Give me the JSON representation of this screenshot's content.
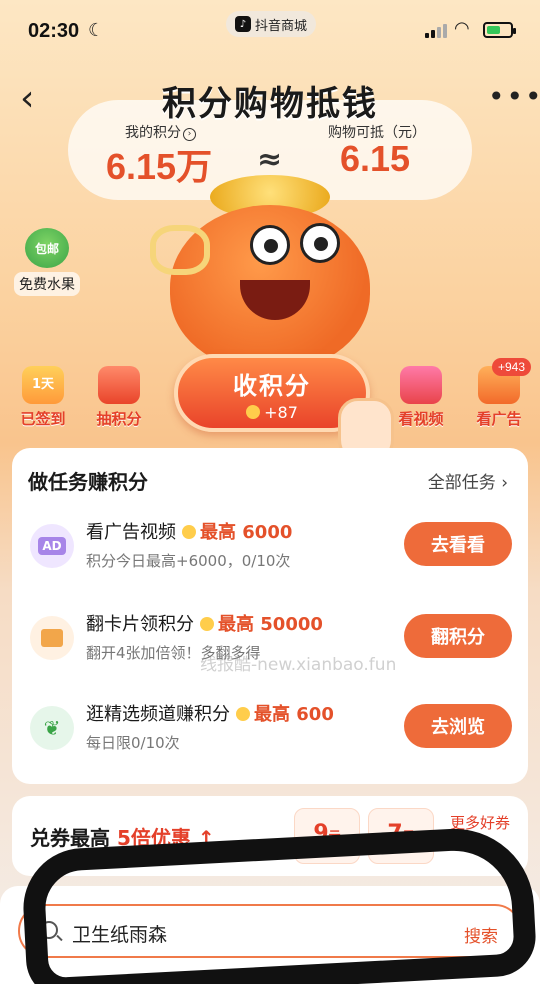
{
  "status_bar": {
    "time": "02:30",
    "app_name": "抖音商城",
    "battery_level": 0.6
  },
  "header": {
    "title": "积分购物抵钱"
  },
  "points": {
    "my_points_label": "我的积分",
    "my_points_value": "6.15万",
    "approx_symbol": "≈",
    "deductible_label": "购物可抵（元）",
    "deductible_value": "6.15"
  },
  "side_entry": {
    "badge": "包邮",
    "label": "免费水果"
  },
  "actions": {
    "signed": {
      "day": "1天",
      "label": "已签到"
    },
    "draw_points": {
      "label": "抽积分"
    },
    "collect": {
      "label": "收积分",
      "amount": "+87"
    },
    "watch_video": {
      "label": "看视频"
    },
    "watch_ads": {
      "label": "看广告",
      "badge": "+943"
    }
  },
  "tasks": {
    "title": "做任务赚积分",
    "all_label": "全部任务",
    "items": [
      {
        "icon": "ad-icon",
        "icon_text": "AD",
        "name": "看广告视频",
        "max": "最高 6000",
        "sub": "积分今日最高+6000，0/10次",
        "button": "去看看"
      },
      {
        "icon": "cards-icon",
        "icon_text": "",
        "name": "翻卡片领积分",
        "max": "最高 50000",
        "sub": "翻开4张加倍领！多翻多得",
        "button": "翻积分"
      },
      {
        "icon": "sprout-icon",
        "icon_text": "",
        "name": "逛精选频道赚积分",
        "max": "最高 600",
        "sub": "每日限0/10次",
        "button": "去浏览"
      }
    ]
  },
  "watermark": "线报酷-new.xianbao.fun",
  "coupon": {
    "title_prefix": "兑券最高",
    "title_highlight": "5倍优惠",
    "coupons": [
      {
        "value": "9",
        "unit": "元"
      },
      {
        "value": "7",
        "unit": "元"
      }
    ],
    "more_label": "更多好券"
  },
  "search": {
    "value": "卫生纸雨森",
    "button": "搜索"
  },
  "colors": {
    "accent": "#e4512a",
    "button": "#ee6b3a"
  }
}
